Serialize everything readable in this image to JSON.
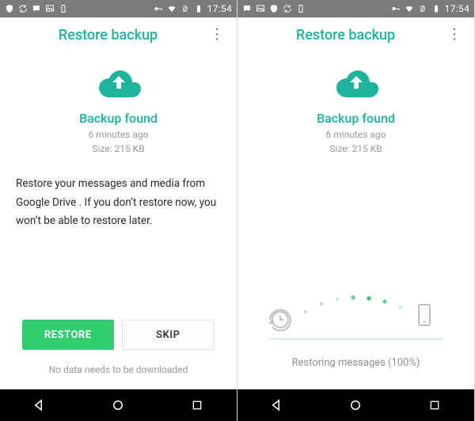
{
  "status": {
    "time": "17:54"
  },
  "left": {
    "title": "Restore backup",
    "backup": {
      "heading": "Backup found",
      "time": "6 minutes ago",
      "size": "Size: 215 KB"
    },
    "description": "Restore your messages and media from Google Drive . If you don’t restore now, you won’t be able to restore later.",
    "buttons": {
      "restore": "RESTORE",
      "skip": "SKIP"
    },
    "hint": "No data needs to be downloaded"
  },
  "right": {
    "title": "Restore backup",
    "backup": {
      "heading": "Backup found",
      "time": "6 minutes ago",
      "size": "Size: 215 KB"
    },
    "progress": {
      "percent": 100,
      "text": "Restoring messages (100%)"
    }
  },
  "colors": {
    "accent": "#1cb49b",
    "primaryButton": "#2fce6c"
  }
}
